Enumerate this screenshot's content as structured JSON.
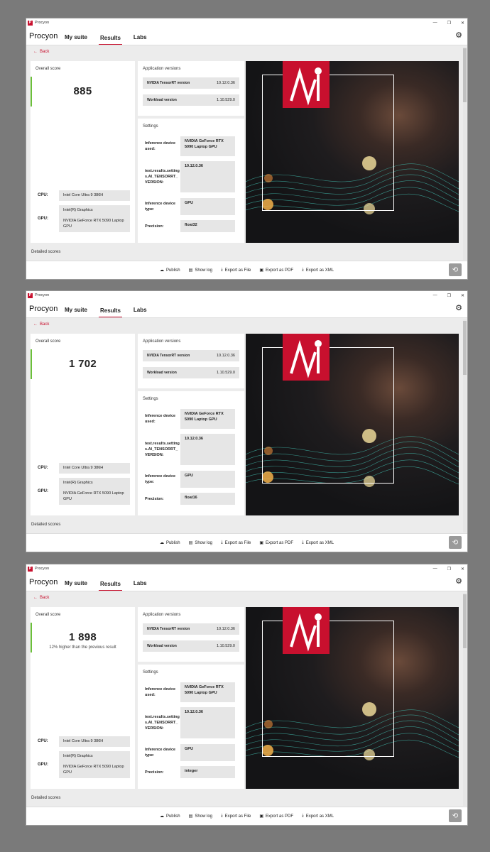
{
  "windows": [
    {
      "title": "Procyon",
      "brand": "Procyon",
      "nav": [
        "My suite",
        "Results",
        "Labs"
      ],
      "back": "Back",
      "overall_title": "Overall score",
      "score": "885",
      "delta": "",
      "cpu_label": "CPU:",
      "cpu": "Intel Core Ultra 9 386H",
      "gpu_label": "GPU:",
      "gpu1": "Intel(R) Graphics",
      "gpu2": "NVIDIA GeForce RTX 5090 Laptop GPU",
      "app_title": "Application versions",
      "tensorrt_label": "NVIDIA TensorRT version",
      "tensorrt_value": "10.12.0.36",
      "workload_label": "Workload version",
      "workload_value": "1.10.529.0",
      "settings_title": "Settings",
      "s1_label": "Inference device used:",
      "s1_value": "NVIDIA GeForce RTX 5090 Laptop GPU",
      "s2_label": "test.results.settings.AI_TENSORRT_VERSION:",
      "s2_value": "10.12.0.36",
      "s3_label": "Inference device type:",
      "s3_value": "GPU",
      "s4_label": "Precision:",
      "s4_value": "float32",
      "detailed": "Detailed scores",
      "footer": [
        "Publish",
        "Show log",
        "Export as File",
        "Export as PDF",
        "Export as XML"
      ]
    },
    {
      "title": "Procyon",
      "brand": "Procyon",
      "nav": [
        "My suite",
        "Results",
        "Labs"
      ],
      "back": "Back",
      "overall_title": "Overall score",
      "score": "1 702",
      "delta": "",
      "cpu_label": "CPU:",
      "cpu": "Intel Core Ultra 9 386H",
      "gpu_label": "GPU:",
      "gpu1": "Intel(R) Graphics",
      "gpu2": "NVIDIA GeForce RTX 5090 Laptop GPU",
      "app_title": "Application versions",
      "tensorrt_label": "NVIDIA TensorRT version",
      "tensorrt_value": "10.12.0.36",
      "workload_label": "Workload version",
      "workload_value": "1.10.529.0",
      "settings_title": "Settings",
      "s1_label": "Inference device used:",
      "s1_value": "NVIDIA GeForce RTX 5090 Laptop GPU",
      "s2_label": "test.results.settings.AI_TENSORRT_VERSION:",
      "s2_value": "10.12.0.36",
      "s3_label": "Inference device type:",
      "s3_value": "GPU",
      "s4_label": "Precision:",
      "s4_value": "float16",
      "detailed": "Detailed scores",
      "footer": [
        "Publish",
        "Show log",
        "Export as File",
        "Export as PDF",
        "Export as XML"
      ]
    },
    {
      "title": "Procyon",
      "brand": "Procyon",
      "nav": [
        "My suite",
        "Results",
        "Labs"
      ],
      "back": "Back",
      "overall_title": "Overall score",
      "score": "1 898",
      "delta": "12% higher than the previous result",
      "cpu_label": "CPU:",
      "cpu": "Intel Core Ultra 9 386H",
      "gpu_label": "GPU:",
      "gpu1": "Intel(R) Graphics",
      "gpu2": "NVIDIA GeForce RTX 5090 Laptop GPU",
      "app_title": "Application versions",
      "tensorrt_label": "NVIDIA TensorRT version",
      "tensorrt_value": "10.12.0.36",
      "workload_label": "Workload version",
      "workload_value": "1.10.529.0",
      "settings_title": "Settings",
      "s1_label": "Inference device used:",
      "s1_value": "NVIDIA GeForce RTX 5090 Laptop GPU",
      "s2_label": "test.results.settings.AI_TENSORRT_VERSION:",
      "s2_value": "10.12.0.36",
      "s3_label": "Inference device type:",
      "s3_value": "GPU",
      "s4_label": "Precision:",
      "s4_value": "integer",
      "detailed": "Detailed scores",
      "footer": [
        "Publish",
        "Show log",
        "Export as File",
        "Export as PDF",
        "Export as XML"
      ]
    }
  ],
  "icons": {
    "back": "arrow-left-icon",
    "settings": "gear-icon",
    "publish": "cloud-upload-icon",
    "show_log": "document-icon",
    "export_file": "download-icon",
    "export_pdf": "save-icon",
    "export_xml": "download-icon",
    "fab": "app-switch-icon"
  },
  "colors": {
    "accent": "#c8102e",
    "score_bar": "#6bbf3a"
  }
}
